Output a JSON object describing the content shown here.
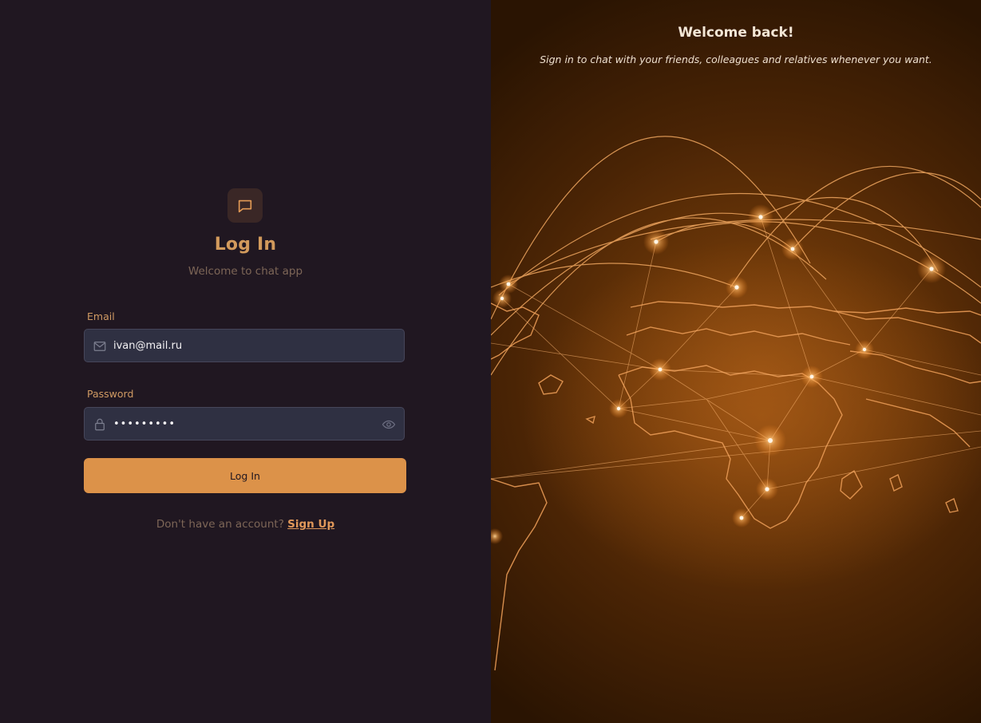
{
  "login": {
    "title": "Log In",
    "subtitle": "Welcome to chat app",
    "logo_icon": "chat-bubble-icon",
    "email": {
      "label": "Email",
      "value": "ivan@mail.ru",
      "icon": "mail-icon"
    },
    "password": {
      "label": "Password",
      "value": "•••••••••",
      "icon": "lock-icon",
      "toggle_icon": "eye-icon"
    },
    "submit_label": "Log In",
    "signup_prompt": "Don't have an account?",
    "signup_link": "Sign Up"
  },
  "hero": {
    "title": "Welcome back!",
    "subtitle": "Sign in to chat with your friends, colleagues and relatives whenever you want."
  },
  "colors": {
    "background": "#201721",
    "accent": "#dc9249",
    "input_bg": "#2f3042",
    "title": "#d29a5c"
  }
}
